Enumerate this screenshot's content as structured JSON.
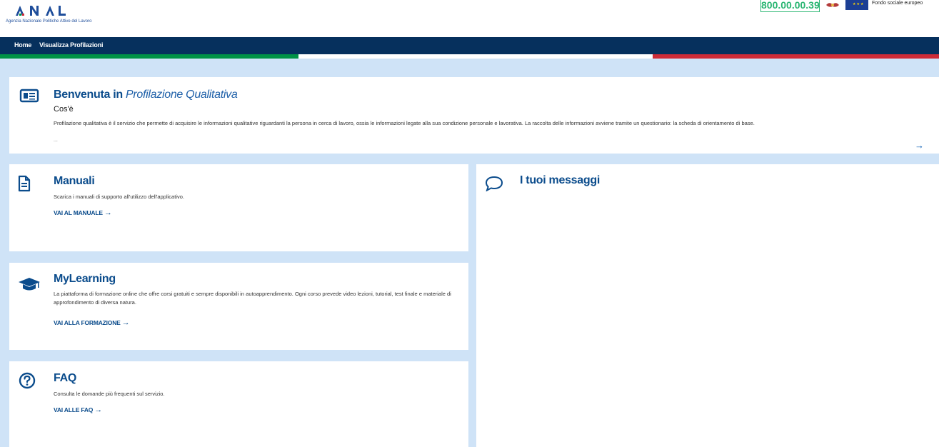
{
  "header": {
    "org_name": "Agenzia Nazionale Politiche Attive del Lavoro",
    "phone": "800.00.00.39",
    "fse_label": "Fondo sociale europeo",
    "colors": {
      "green": "#2bb673",
      "navy": "#06305d"
    }
  },
  "nav": {
    "items": [
      {
        "label": "Home"
      },
      {
        "label": "Visualizza Profilazioni"
      }
    ]
  },
  "welcome": {
    "title_prefix": "Benvenuta in",
    "title_app": "Profilazione Qualitativa",
    "subtitle": "Cos'è",
    "description": "Profilazione qualitativa è il servizio che permette di acquisire le informazioni qualitative riguardanti la persona in cerca di lavoro, ossia le informazioni legate alla sua condizione personale e lavorativa. La raccolta delle informazioni avviene tramite un questionario: la scheda di orientamento di base.",
    "ellipsis": "...",
    "more_icon": "arrow-right-icon"
  },
  "manuali": {
    "title": "Manuali",
    "description": "Scarica i manuali di supporto all'utilizzo dell'applicativo.",
    "link": "VAI AL MANUALE",
    "icon": "document-icon"
  },
  "mylearning": {
    "title": "MyLearning",
    "description": "La piattaforma di formazione online che offre corsi gratuiti e sempre disponibili in autoapprendimento. Ogni corso prevede video lezioni, tutorial, test finale e materiale di approfondimento di diversa natura.",
    "link": "VAI ALLA FORMAZIONE",
    "icon": "graduation-cap-icon"
  },
  "faq": {
    "title": "FAQ",
    "description": "Consulta le domande più frequenti sul servizio.",
    "link": "VAI ALLE FAQ",
    "icon": "question-circle-icon"
  },
  "messages": {
    "title": "I tuoi messaggi",
    "icon": "speech-bubble-icon"
  },
  "flag_colors": [
    "#009246",
    "#ffffff",
    "#ce2b37"
  ]
}
